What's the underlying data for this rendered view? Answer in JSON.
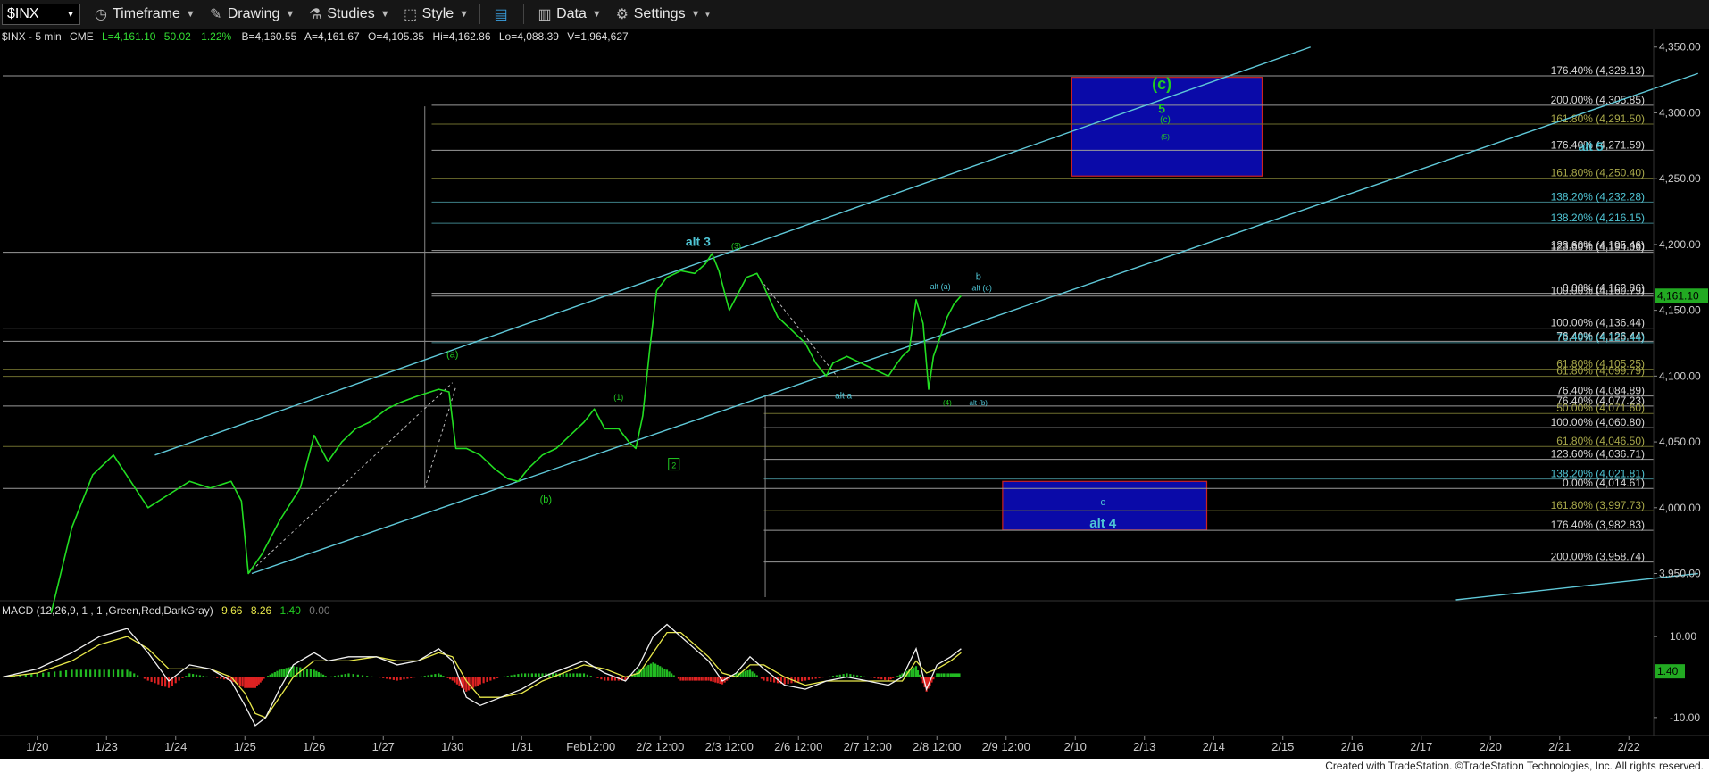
{
  "toolbar": {
    "symbol": "$INX",
    "timeframe": "Timeframe",
    "drawing": "Drawing",
    "studies": "Studies",
    "style": "Style",
    "data": "Data",
    "settings": "Settings"
  },
  "header": {
    "symbol": "$INX - 5 min",
    "exchange": "CME",
    "last": "L=4,161.10",
    "change": "50.02",
    "pct": "1.22%",
    "bid": "B=4,160.55",
    "ask": "A=4,161.67",
    "open": "O=4,105.35",
    "high": "Hi=4,162.86",
    "low": "Lo=4,088.39",
    "volume": "V=1,964,627"
  },
  "colors": {
    "background": "#000000",
    "price": "#22dd22",
    "channel": "#5fc8d8",
    "fib_white": "#d8d8d8",
    "fib_gold": "#a8a84a",
    "fib_cyan": "#5fb0b8",
    "box_fill": "#0a0aa8",
    "box_border": "#cc2222",
    "wave_green": "#22cc22",
    "wave_cyan": "#4fc4d4"
  },
  "chart_data": {
    "type": "line",
    "title": "$INX - 5 min",
    "ylim": [
      3930,
      4360
    ],
    "y_ticks": [
      "4,350.00",
      "4,300.00",
      "4,250.00",
      "4,200.00",
      "4,150.00",
      "4,100.00",
      "4,050.00",
      "4,000.00",
      "3,950.00"
    ],
    "y_tick_values": [
      4350,
      4300,
      4250,
      4200,
      4150,
      4100,
      4050,
      4000,
      3950
    ],
    "x_ticks": [
      "1/20",
      "1/23",
      "1/24",
      "1/25",
      "1/26",
      "1/27",
      "1/30",
      "1/31",
      "Feb12:00",
      "2/2 12:00",
      "2/3 12:00",
      "2/6 12:00",
      "2/7 12:00",
      "2/8 12:00",
      "2/9 12:00",
      "2/10",
      "2/13",
      "2/14",
      "2/15",
      "2/16",
      "2/17",
      "2/20",
      "2/21",
      "2/22"
    ],
    "x_tick_values": [
      0.5,
      1.5,
      2.5,
      3.5,
      4.5,
      5.5,
      6.5,
      7.5,
      8.5,
      9.5,
      10.5,
      11.5,
      12.5,
      13.5,
      14.5,
      15.5,
      16.5,
      17.5,
      18.5,
      19.5,
      20.5,
      21.5,
      22.5,
      23.5
    ],
    "last_price": "4,161.10",
    "last_price_value": 4161.1,
    "series": [
      {
        "values": [
          [
            0.7,
            3920
          ],
          [
            1.0,
            3985
          ],
          [
            1.3,
            4025
          ],
          [
            1.6,
            4040
          ],
          [
            1.85,
            4020
          ],
          [
            2.1,
            4000
          ],
          [
            2.4,
            4010
          ],
          [
            2.7,
            4020
          ],
          [
            3.0,
            4015
          ],
          [
            3.3,
            4020
          ],
          [
            3.45,
            4005
          ],
          [
            3.55,
            3950
          ],
          [
            3.75,
            3965
          ],
          [
            4.0,
            3990
          ],
          [
            4.3,
            4015
          ],
          [
            4.5,
            4055
          ],
          [
            4.7,
            4035
          ],
          [
            4.9,
            4050
          ],
          [
            5.1,
            4060
          ],
          [
            5.3,
            4065
          ],
          [
            5.55,
            4075
          ],
          [
            5.75,
            4080
          ],
          [
            6.0,
            4085
          ],
          [
            6.3,
            4090
          ],
          [
            6.45,
            4088
          ],
          [
            6.55,
            4045
          ],
          [
            6.7,
            4045
          ],
          [
            6.9,
            4040
          ],
          [
            7.1,
            4030
          ],
          [
            7.3,
            4022
          ],
          [
            7.45,
            4020
          ],
          [
            7.6,
            4030
          ],
          [
            7.8,
            4040
          ],
          [
            8.0,
            4045
          ],
          [
            8.2,
            4055
          ],
          [
            8.4,
            4065
          ],
          [
            8.55,
            4075
          ],
          [
            8.7,
            4060
          ],
          [
            8.9,
            4060
          ],
          [
            9.05,
            4050
          ],
          [
            9.15,
            4045
          ],
          [
            9.25,
            4070
          ],
          [
            9.35,
            4120
          ],
          [
            9.45,
            4165
          ],
          [
            9.6,
            4175
          ],
          [
            9.8,
            4180
          ],
          [
            10.0,
            4178
          ],
          [
            10.15,
            4185
          ],
          [
            10.25,
            4193
          ],
          [
            10.35,
            4180
          ],
          [
            10.5,
            4150
          ],
          [
            10.6,
            4160
          ],
          [
            10.75,
            4175
          ],
          [
            10.9,
            4178
          ],
          [
            11.0,
            4168
          ],
          [
            11.2,
            4145
          ],
          [
            11.4,
            4135
          ],
          [
            11.6,
            4125
          ],
          [
            11.75,
            4110
          ],
          [
            11.9,
            4100
          ],
          [
            12.0,
            4110
          ],
          [
            12.2,
            4115
          ],
          [
            12.4,
            4110
          ],
          [
            12.6,
            4105
          ],
          [
            12.8,
            4100
          ],
          [
            12.9,
            4108
          ],
          [
            13.0,
            4115
          ],
          [
            13.1,
            4120
          ],
          [
            13.2,
            4158
          ],
          [
            13.3,
            4140
          ],
          [
            13.38,
            4090
          ],
          [
            13.45,
            4115
          ],
          [
            13.55,
            4130
          ],
          [
            13.65,
            4145
          ],
          [
            13.75,
            4155
          ],
          [
            13.85,
            4161
          ]
        ]
      }
    ],
    "macd": {
      "label": "MACD (12,26,9, 1 , 1 ,Green,Red,DarkGray)",
      "macd": "9.66",
      "signal": "8.26",
      "hist": "1.40",
      "zero": "0.00",
      "ylim": [
        -14,
        14
      ],
      "y_ticks": [
        "10.00",
        "-10.00"
      ],
      "y_tick_values": [
        10,
        -10
      ],
      "last_value_label": "1.40",
      "macd_line": [
        [
          0.0,
          0
        ],
        [
          0.5,
          2
        ],
        [
          1.0,
          6
        ],
        [
          1.4,
          10
        ],
        [
          1.8,
          12
        ],
        [
          2.1,
          6
        ],
        [
          2.4,
          -1
        ],
        [
          2.7,
          3
        ],
        [
          3.0,
          2
        ],
        [
          3.3,
          -1
        ],
        [
          3.5,
          -7
        ],
        [
          3.65,
          -12
        ],
        [
          3.8,
          -10
        ],
        [
          4.0,
          -3
        ],
        [
          4.2,
          3
        ],
        [
          4.5,
          6
        ],
        [
          4.7,
          4
        ],
        [
          5.0,
          5
        ],
        [
          5.4,
          5
        ],
        [
          5.7,
          3
        ],
        [
          6.0,
          4
        ],
        [
          6.3,
          7
        ],
        [
          6.5,
          4
        ],
        [
          6.7,
          -5
        ],
        [
          6.9,
          -7
        ],
        [
          7.2,
          -5
        ],
        [
          7.5,
          -3
        ],
        [
          7.8,
          0
        ],
        [
          8.1,
          2
        ],
        [
          8.4,
          4
        ],
        [
          8.7,
          1
        ],
        [
          9.0,
          -1
        ],
        [
          9.2,
          3
        ],
        [
          9.4,
          10
        ],
        [
          9.6,
          13
        ],
        [
          9.8,
          10
        ],
        [
          10.0,
          7
        ],
        [
          10.2,
          4
        ],
        [
          10.4,
          -1
        ],
        [
          10.6,
          1
        ],
        [
          10.8,
          5
        ],
        [
          11.0,
          2
        ],
        [
          11.3,
          -2
        ],
        [
          11.6,
          -3
        ],
        [
          11.9,
          -1
        ],
        [
          12.2,
          0
        ],
        [
          12.5,
          -1
        ],
        [
          12.8,
          -2
        ],
        [
          13.0,
          0
        ],
        [
          13.2,
          7
        ],
        [
          13.35,
          -3
        ],
        [
          13.5,
          3
        ],
        [
          13.7,
          5
        ],
        [
          13.85,
          7
        ]
      ],
      "signal_line": [
        [
          0.0,
          0
        ],
        [
          0.5,
          1
        ],
        [
          1.0,
          4
        ],
        [
          1.4,
          8
        ],
        [
          1.8,
          10
        ],
        [
          2.1,
          7
        ],
        [
          2.4,
          2
        ],
        [
          2.7,
          2
        ],
        [
          3.0,
          2
        ],
        [
          3.3,
          0
        ],
        [
          3.5,
          -4
        ],
        [
          3.65,
          -9
        ],
        [
          3.8,
          -10
        ],
        [
          4.0,
          -5
        ],
        [
          4.2,
          0
        ],
        [
          4.5,
          4
        ],
        [
          4.7,
          4
        ],
        [
          5.0,
          4
        ],
        [
          5.4,
          5
        ],
        [
          5.7,
          4
        ],
        [
          6.0,
          4
        ],
        [
          6.3,
          6
        ],
        [
          6.5,
          5
        ],
        [
          6.7,
          -1
        ],
        [
          6.9,
          -5
        ],
        [
          7.2,
          -5
        ],
        [
          7.5,
          -4
        ],
        [
          7.8,
          -1
        ],
        [
          8.1,
          1
        ],
        [
          8.4,
          3
        ],
        [
          8.7,
          2
        ],
        [
          9.0,
          0
        ],
        [
          9.2,
          1
        ],
        [
          9.4,
          6
        ],
        [
          9.6,
          11
        ],
        [
          9.8,
          11
        ],
        [
          10.0,
          8
        ],
        [
          10.2,
          5
        ],
        [
          10.4,
          1
        ],
        [
          10.6,
          0
        ],
        [
          10.8,
          3
        ],
        [
          11.0,
          3
        ],
        [
          11.3,
          0
        ],
        [
          11.6,
          -2
        ],
        [
          11.9,
          -1
        ],
        [
          12.2,
          -1
        ],
        [
          12.5,
          -1
        ],
        [
          12.8,
          -1
        ],
        [
          13.0,
          -1
        ],
        [
          13.2,
          4
        ],
        [
          13.35,
          1
        ],
        [
          13.5,
          2
        ],
        [
          13.7,
          4
        ],
        [
          13.85,
          6
        ]
      ]
    },
    "fib_levels": [
      {
        "label": "176.40% (4,328.13)",
        "value": 4328.13,
        "color": "white",
        "x0": 0.0
      },
      {
        "label": "200.00% (4,305.85)",
        "value": 4305.85,
        "color": "white",
        "x0": 6.2
      },
      {
        "label": "161.80% (4,291.50)",
        "value": 4291.5,
        "color": "gold",
        "x0": 6.2
      },
      {
        "label": "176.40% (4,271.59)",
        "value": 4271.59,
        "color": "white",
        "x0": 6.2
      },
      {
        "label": "161.80% (4,250.40)",
        "value": 4250.4,
        "color": "gold",
        "x0": 6.2
      },
      {
        "label": "138.20% (4,232.28)",
        "value": 4232.28,
        "color": "cyan",
        "x0": 6.2
      },
      {
        "label": "138.20% (4,216.15)",
        "value": 4216.15,
        "color": "cyan",
        "x0": 6.2
      },
      {
        "label": "123.60% (4,194.06)",
        "value": 4194.06,
        "color": "white",
        "x0": 0.0
      },
      {
        "label": "123.60% (4,195.46)",
        "value": 4195.46,
        "color": "white",
        "x0": 6.2
      },
      {
        "label": "0.00% (4,162.86)",
        "value": 4162.86,
        "color": "white",
        "x0": 6.2
      },
      {
        "label": "100.00% (4,160.79)",
        "value": 4160.79,
        "color": "white",
        "x0": 6.2
      },
      {
        "label": "100.00% (4,136.44)",
        "value": 4136.44,
        "color": "white",
        "x0": 0.0
      },
      {
        "label": "76.40% (4,126.44)",
        "value": 4126.44,
        "color": "white",
        "x0": 0.0
      },
      {
        "label": "76.40% (4,125.44)",
        "value": 4125.44,
        "color": "cyan",
        "x0": 6.2
      },
      {
        "label": "61.80% (4,105.25)",
        "value": 4105.25,
        "color": "gold",
        "x0": 0.0
      },
      {
        "label": "61.80% (4,099.79)",
        "value": 4099.79,
        "color": "gold",
        "x0": 0.0
      },
      {
        "label": "76.40% (4,084.89)",
        "value": 4084.89,
        "color": "white",
        "x0": 11.0
      },
      {
        "label": "76.40% (4,077.23)",
        "value": 4077.23,
        "color": "white",
        "x0": 0.0
      },
      {
        "label": "50.00% (4,071.60)",
        "value": 4071.6,
        "color": "gold",
        "x0": 11.0
      },
      {
        "label": "100.00% (4,060.80)",
        "value": 4060.8,
        "color": "white",
        "x0": 11.0
      },
      {
        "label": "61.80% (4,046.50)",
        "value": 4046.5,
        "color": "gold",
        "x0": 0.0
      },
      {
        "label": "123.60% (4,036.71)",
        "value": 4036.71,
        "color": "white",
        "x0": 11.0
      },
      {
        "label": "138.20% (4,021.81)",
        "value": 4021.81,
        "color": "cyan",
        "x0": 11.0
      },
      {
        "label": "0.00% (4,014.61)",
        "value": 4014.61,
        "color": "white",
        "x0": 0.0
      },
      {
        "label": "161.80% (3,997.73)",
        "value": 3997.73,
        "color": "gold",
        "x0": 11.0
      },
      {
        "label": "176.40% (3,982.83)",
        "value": 3982.83,
        "color": "white",
        "x0": 11.0
      },
      {
        "label": "200.00% (3,958.74)",
        "value": 3958.74,
        "color": "white",
        "x0": 11.0
      }
    ],
    "channel_lines": [
      {
        "from": [
          2.2,
          4040
        ],
        "to": [
          18.9,
          4350
        ]
      },
      {
        "from": [
          3.6,
          3950
        ],
        "to": [
          24.5,
          4330
        ]
      },
      {
        "from": [
          21.0,
          3930
        ],
        "to": [
          24.5,
          3950
        ]
      }
    ],
    "target_boxes": [
      {
        "x0": 15.45,
        "x1": 18.2,
        "y0": 4252,
        "y1": 4327
      },
      {
        "x0": 14.45,
        "x1": 17.4,
        "y0": 3983,
        "y1": 4020
      }
    ],
    "labels": [
      {
        "text": "(c)",
        "x": 16.75,
        "y": 4318,
        "color": "green",
        "size": 18
      },
      {
        "text": "5",
        "x": 16.75,
        "y": 4300,
        "color": "green",
        "size": 14
      },
      {
        "text": "(c)",
        "x": 16.8,
        "y": 4293,
        "color": "green",
        "size": 10
      },
      {
        "text": "(5)",
        "x": 16.8,
        "y": 4280,
        "color": "green",
        "size": 8
      },
      {
        "text": "alt 5",
        "x": 22.95,
        "y": 4271,
        "color": "cyan",
        "size": 14
      },
      {
        "text": "alt 3",
        "x": 10.05,
        "y": 4199,
        "color": "cyan",
        "size": 14
      },
      {
        "text": "(3)",
        "x": 10.6,
        "y": 4197,
        "color": "green",
        "size": 9
      },
      {
        "text": "b",
        "x": 14.1,
        "y": 4173,
        "color": "cyan",
        "size": 11
      },
      {
        "text": "alt (a)",
        "x": 13.55,
        "y": 4166,
        "color": "cyan",
        "size": 9
      },
      {
        "text": "alt (c)",
        "x": 14.15,
        "y": 4165,
        "color": "cyan",
        "size": 9
      },
      {
        "text": "(a)",
        "x": 6.5,
        "y": 4114,
        "color": "green",
        "size": 11
      },
      {
        "text": "(1)",
        "x": 8.9,
        "y": 4082,
        "color": "green",
        "size": 9
      },
      {
        "text": "alt a",
        "x": 12.15,
        "y": 4083,
        "color": "cyan",
        "size": 10
      },
      {
        "text": "(4)",
        "x": 13.65,
        "y": 4078,
        "color": "green",
        "size": 8
      },
      {
        "text": "alt (b)",
        "x": 14.1,
        "y": 4078,
        "color": "cyan",
        "size": 8
      },
      {
        "text": "2",
        "x": 9.7,
        "y": 4030,
        "color": "green",
        "size": 9,
        "boxed": true
      },
      {
        "text": "(b)",
        "x": 7.85,
        "y": 4004,
        "color": "green",
        "size": 11
      },
      {
        "text": "c",
        "x": 15.9,
        "y": 4002,
        "color": "cyan",
        "size": 11
      },
      {
        "text": "alt 4",
        "x": 15.9,
        "y": 3985,
        "color": "cyan",
        "size": 15
      }
    ],
    "dashed_lines": [
      {
        "from": [
          3.55,
          3950
        ],
        "to": [
          6.5,
          4095
        ]
      },
      {
        "from": [
          6.1,
          4015
        ],
        "to": [
          6.55,
          4092
        ]
      },
      {
        "from": [
          11.0,
          4170
        ],
        "to": [
          12.1,
          4097
        ]
      }
    ],
    "vertical_lines": [
      {
        "x": 6.1,
        "y0": 4014.61,
        "y1": 4305
      },
      {
        "x": 11.02,
        "y0": 3932,
        "y1": 4085
      }
    ]
  },
  "footer": {
    "text": "Created with TradeStation. ©TradeStation Technologies, Inc. All rights reserved."
  }
}
